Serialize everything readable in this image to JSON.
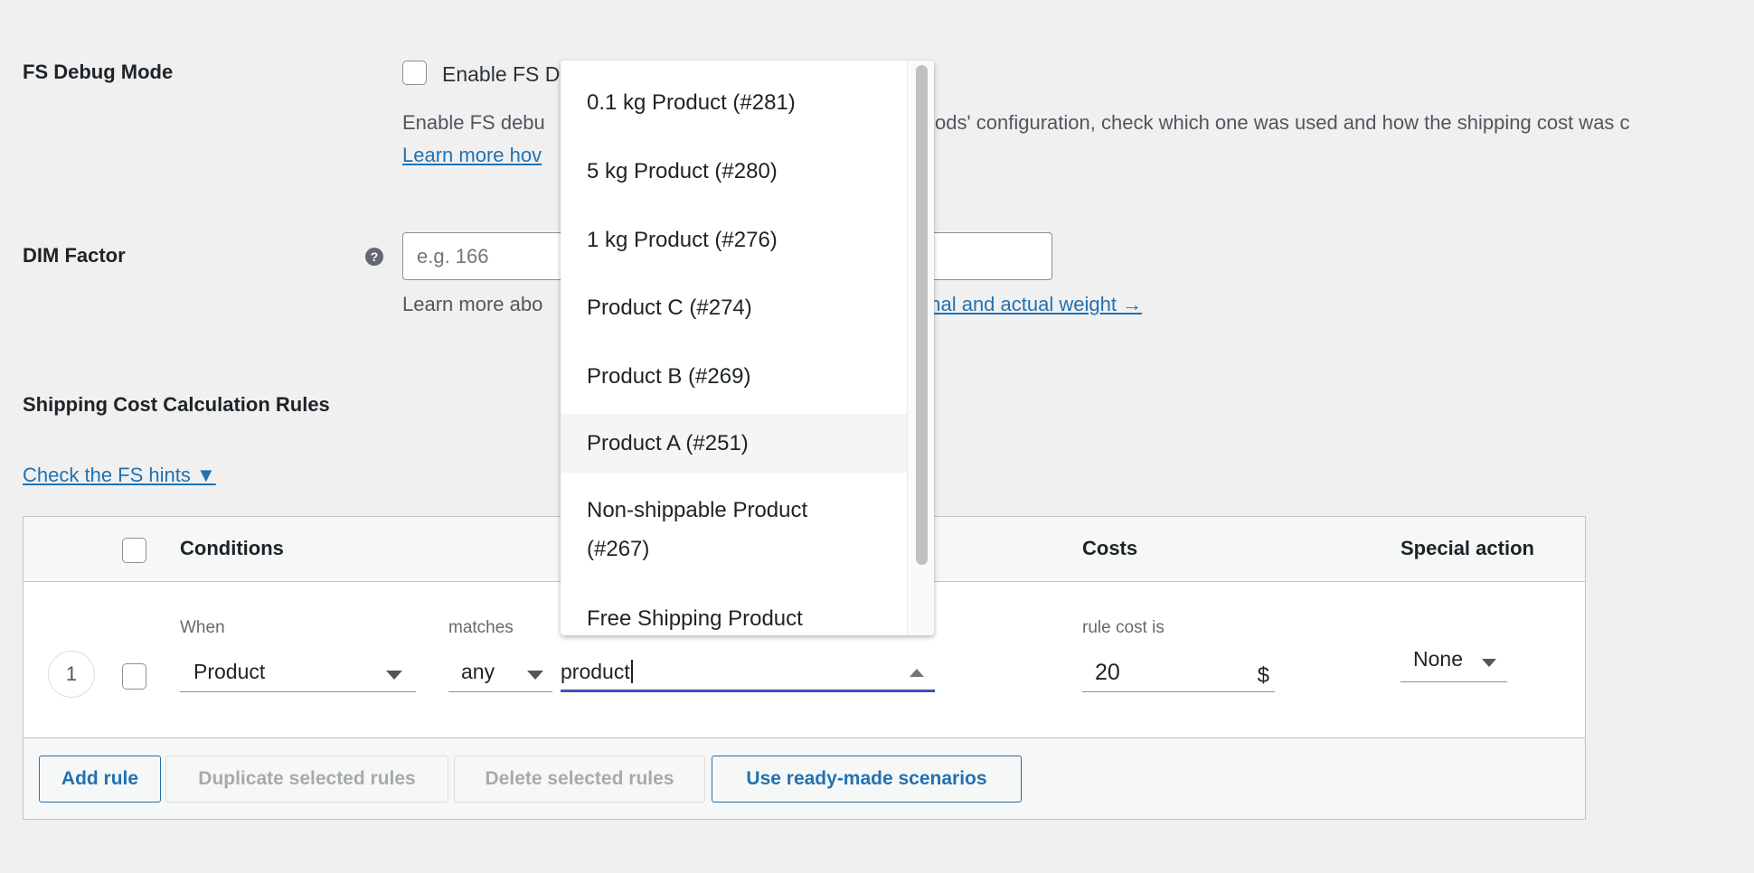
{
  "debug": {
    "label": "FS Debug Mode",
    "checkbox_label": "Enable FS D",
    "desc_left": "Enable FS debu",
    "desc_right": "ods' configuration, check which one was used and how the shipping cost was c",
    "link_left": "Learn more hov"
  },
  "dim": {
    "label": "DIM Factor",
    "help_icon": "question-circle-icon",
    "placeholder": "e.g. 166",
    "desc_left": "Learn more abo",
    "link_right": "onal and actual weight →"
  },
  "rules": {
    "title": "Shipping Cost Calculation Rules",
    "hints_link": "Check the FS hints ▼"
  },
  "table": {
    "headers": {
      "conditions": "Conditions",
      "costs": "Costs",
      "special": "Special action"
    },
    "row": {
      "number": "1",
      "when_label": "When",
      "when_value": "Product",
      "matches_label": "matches",
      "matches_value": "any",
      "search_value": "product",
      "cost_label": "rule cost is",
      "cost_value": "20",
      "currency": "$",
      "special_value": "None"
    },
    "buttons": {
      "add": "Add rule",
      "duplicate": "Duplicate selected rules",
      "delete": "Delete selected rules",
      "scenarios": "Use ready-made scenarios"
    }
  },
  "dropdown": {
    "highlighted": "Product A (#251)",
    "items": [
      "0.1 kg Product (#281)",
      "5 kg Product (#280)",
      "1 kg Product (#276)",
      "Product C (#274)",
      "Product B (#269)",
      "Product A (#251)",
      "Non-shippable Product (#267)",
      "Free Shipping Product"
    ]
  },
  "colors": {
    "accent": "#2271b1",
    "focus_underline": "#3f51b5",
    "highlight": "#f5f5f5"
  }
}
